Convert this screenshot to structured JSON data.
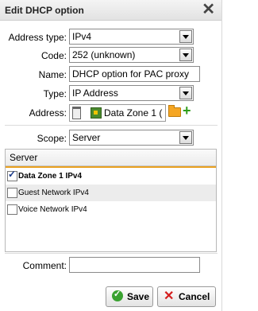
{
  "dialog": {
    "title": "Edit DHCP option"
  },
  "fields": {
    "address_type": {
      "label": "Address type:",
      "value": "IPv4"
    },
    "code": {
      "label": "Code:",
      "value": "252 (unknown)"
    },
    "name": {
      "label": "Name:",
      "value": "DHCP option for PAC proxy"
    },
    "type": {
      "label": "Type:",
      "value": "IP Address"
    },
    "address": {
      "label": "Address:",
      "value": "Data Zone 1 ("
    },
    "scope": {
      "label": "Scope:",
      "value": "Server"
    }
  },
  "server_panel": {
    "header": "Server",
    "rows": [
      {
        "label": "Data Zone 1 IPv4",
        "checked": true
      },
      {
        "label": "Guest Network IPv4",
        "checked": false
      },
      {
        "label": "Voice Network IPv4",
        "checked": false
      }
    ]
  },
  "comment": {
    "label": "Comment:",
    "value": ""
  },
  "buttons": {
    "save": "Save",
    "cancel": "Cancel"
  },
  "colors": {
    "accent": "#e8a020",
    "save_green": "#3aa231",
    "cancel_red": "#d41e1e"
  }
}
